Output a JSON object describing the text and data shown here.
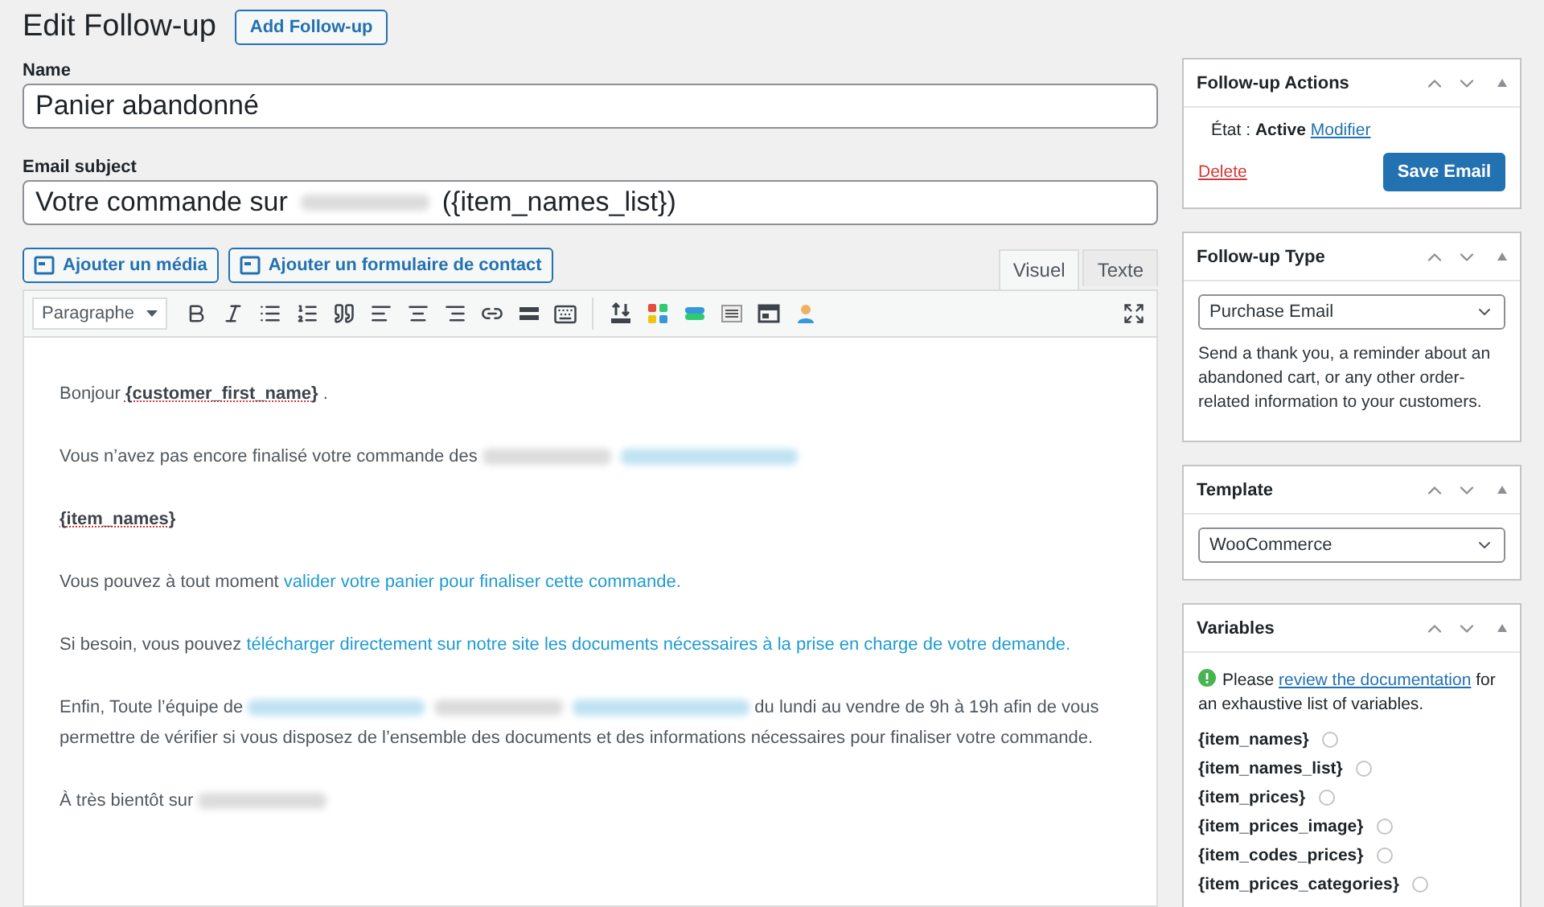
{
  "page": {
    "title": "Edit Follow-up",
    "add_button": "Add Follow-up"
  },
  "name_field": {
    "label": "Name",
    "value": "Panier abandonné"
  },
  "subject_field": {
    "label": "Email subject",
    "segments": [
      {
        "kind": "text",
        "text": "Votre commande sur"
      },
      {
        "kind": "redacted"
      },
      {
        "kind": "text",
        "text": "({item_names_list})"
      }
    ]
  },
  "media_buttons": [
    "Ajouter un média",
    "Ajouter un formulaire de contact"
  ],
  "editor_tabs": [
    {
      "label": "Visuel",
      "selected": true
    },
    {
      "label": "Texte",
      "selected": false
    }
  ],
  "format_select": "Paragraphe",
  "paragraphs": [
    {
      "lines": [
        [
          {
            "kind": "text",
            "text": "Bonjour "
          },
          {
            "kind": "bold",
            "text": "{customer_first_name}"
          },
          {
            "kind": "text",
            "text": " ."
          }
        ]
      ]
    },
    {
      "lines": [
        [
          {
            "kind": "text",
            "text": "Vous n’avez pas encore finalisé votre commande des"
          },
          {
            "kind": "redacted"
          },
          {
            "kind": "redacted_link"
          }
        ]
      ]
    },
    {
      "lines": [
        [
          {
            "kind": "bold",
            "text": "{item_names}"
          }
        ]
      ]
    },
    {
      "lines": [
        [
          {
            "kind": "text",
            "text": "Vous pouvez à tout moment "
          },
          {
            "kind": "link",
            "text": "valider votre panier pour finaliser cette commande."
          }
        ]
      ]
    },
    {
      "lines": [
        [
          {
            "kind": "text",
            "text": "Si besoin, vous pouvez "
          },
          {
            "kind": "link",
            "text": "télécharger directement sur notre site les documents nécessaires à la prise en charge de votre demande."
          }
        ]
      ]
    },
    {
      "lines": [
        [
          {
            "kind": "text",
            "text": "Enfin, Toute l’équipe  de"
          },
          {
            "kind": "redacted_link"
          },
          {
            "kind": "redacted"
          },
          {
            "kind": "redacted_link"
          },
          {
            "kind": "text",
            "text": "du lundi au vendre de 9h à 19h afin de vous"
          }
        ],
        [
          {
            "kind": "text",
            "text": "permettre de vérifier si vous disposez de l’ensemble des documents et des informations nécessaires pour finaliser votre commande."
          }
        ]
      ]
    },
    {
      "lines": [
        [
          {
            "kind": "text",
            "text": "À très bientôt sur"
          },
          {
            "kind": "redacted"
          }
        ]
      ]
    }
  ],
  "sidebar": [
    {
      "kind": "actions",
      "title": "Follow-up Actions",
      "status_label": "État : ",
      "status": "Active",
      "modify_link": "Modifier",
      "delete_link": "Delete",
      "save_button": "Save Email"
    },
    {
      "kind": "select",
      "title": "Follow-up Type",
      "value": "Purchase Email",
      "description": "Send a thank you, a reminder about an abandoned cart, or any other order-related information to your customers."
    },
    {
      "kind": "select",
      "title": "Template",
      "value": "WooCommerce"
    },
    {
      "kind": "variables",
      "title": "Variables",
      "notice_before": "Please ",
      "notice_link": "review the documentation",
      "notice_after": " for an exhaustive list of variables.",
      "variables": [
        "{item_names}",
        "{item_names_list}",
        "{item_prices}",
        "{item_prices_image}",
        "{item_codes_prices}",
        "{item_prices_categories}"
      ]
    }
  ]
}
